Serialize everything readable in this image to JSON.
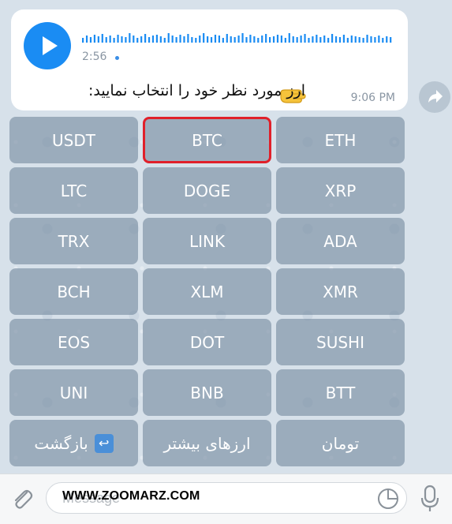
{
  "voice_message": {
    "duration": "2:56",
    "text": "ارز مورد نظر خود را انتخاب نمایید:",
    "time": "9:06 PM",
    "waveform": [
      6,
      9,
      7,
      10,
      8,
      11,
      7,
      9,
      6,
      10,
      8,
      7,
      12,
      9,
      6,
      8,
      11,
      7,
      9,
      10,
      8,
      6,
      12,
      9,
      7,
      10,
      8,
      11,
      7,
      6,
      9,
      12,
      8,
      7,
      10,
      9,
      6,
      11,
      8,
      7,
      9,
      12,
      7,
      10,
      8,
      6,
      9,
      11,
      7,
      8,
      10,
      9,
      6,
      12,
      8,
      7,
      9,
      11,
      6,
      8,
      10,
      7,
      9,
      6,
      11,
      8,
      7,
      10,
      6,
      9,
      8,
      7,
      6,
      10,
      8,
      7,
      9,
      6,
      8,
      7
    ]
  },
  "keyboard": {
    "rows": [
      [
        {
          "label": "USDT"
        },
        {
          "label": "BTC"
        },
        {
          "label": "ETH"
        }
      ],
      [
        {
          "label": "LTC"
        },
        {
          "label": "DOGE"
        },
        {
          "label": "XRP"
        }
      ],
      [
        {
          "label": "TRX"
        },
        {
          "label": "LINK"
        },
        {
          "label": "ADA"
        }
      ],
      [
        {
          "label": "BCH"
        },
        {
          "label": "XLM"
        },
        {
          "label": "XMR"
        }
      ],
      [
        {
          "label": "EOS"
        },
        {
          "label": "DOT"
        },
        {
          "label": "SUSHI"
        }
      ],
      [
        {
          "label": "UNI"
        },
        {
          "label": "BNB"
        },
        {
          "label": "BTT"
        }
      ],
      [
        {
          "label": "بازگشت"
        },
        {
          "label": "ارزهای بیشتر"
        },
        {
          "label": "تومان"
        }
      ]
    ]
  },
  "input": {
    "placeholder": "Message",
    "watermark": "WWW.ZOOMARZ.COM"
  },
  "colors": {
    "accent": "#1a8cf3",
    "key_background": "#8a9cb0",
    "highlight": "#e0202a"
  },
  "icons": [
    "play-icon",
    "forward-icon",
    "pointing-hand-icon",
    "return-arrow-icon",
    "paperclip-icon",
    "sticker-icon",
    "microphone-icon"
  ]
}
